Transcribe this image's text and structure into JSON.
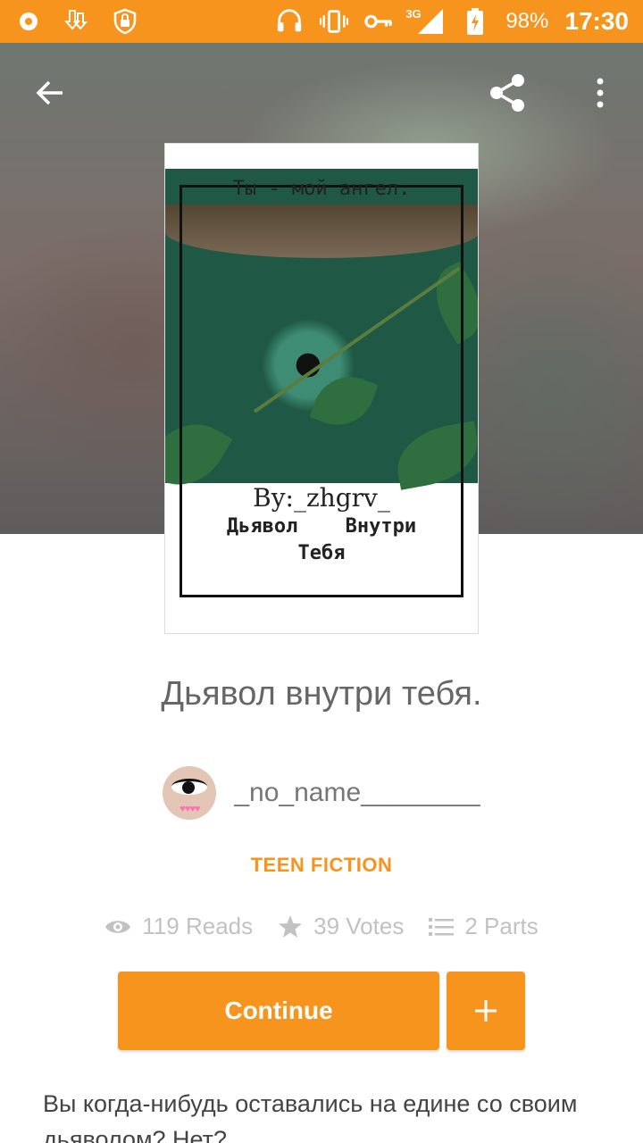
{
  "status_bar": {
    "battery": "98%",
    "network": "3G",
    "time": "17:30"
  },
  "cover": {
    "top_text": "Ты - мой ангел.",
    "byline": "By:_zhgrv_",
    "title_line1": "Дьявол Внутри",
    "title_line2": "Тебя"
  },
  "story": {
    "title": "Дьявол внутри тебя.",
    "author": "_no_name________",
    "category": "TEEN FICTION",
    "reads": "119 Reads",
    "votes": "39 Votes",
    "parts": "2 Parts",
    "description": "Вы когда-нибудь оставались на едине со своим дьяволом? Нет?"
  },
  "actions": {
    "continue_label": "Continue",
    "add_label": "+"
  },
  "colors": {
    "accent": "#f7941e",
    "stats": "#c2c2c2"
  },
  "icons": {
    "back": "arrow-left-icon",
    "share": "share-icon",
    "more": "more-vert-icon",
    "reads": "eye-icon",
    "votes": "star-icon",
    "parts": "list-icon"
  }
}
